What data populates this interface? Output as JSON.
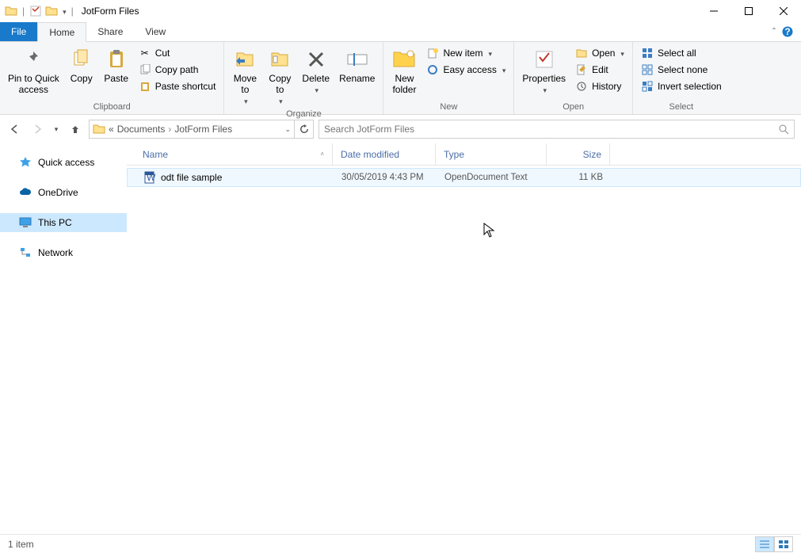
{
  "title": "JotForm Files",
  "tabs": {
    "file": "File",
    "home": "Home",
    "share": "Share",
    "view": "View"
  },
  "ribbon": {
    "clipboard": {
      "pin": "Pin to Quick\naccess",
      "copy": "Copy",
      "paste": "Paste",
      "cut": "Cut",
      "copypath": "Copy path",
      "pasteshortcut": "Paste shortcut",
      "label": "Clipboard"
    },
    "organize": {
      "moveto": "Move\nto",
      "copyto": "Copy\nto",
      "delete": "Delete",
      "rename": "Rename",
      "label": "Organize"
    },
    "new": {
      "newfolder": "New\nfolder",
      "newitem": "New item",
      "easyaccess": "Easy access",
      "label": "New"
    },
    "open": {
      "properties": "Properties",
      "open": "Open",
      "edit": "Edit",
      "history": "History",
      "label": "Open"
    },
    "select": {
      "all": "Select all",
      "none": "Select none",
      "invert": "Invert selection",
      "label": "Select"
    }
  },
  "breadcrumb": {
    "root": "«",
    "a": "Documents",
    "b": "JotForm Files"
  },
  "search_placeholder": "Search JotForm Files",
  "nav": {
    "quick": "Quick access",
    "onedrive": "OneDrive",
    "thispc": "This PC",
    "network": "Network"
  },
  "columns": {
    "name": "Name",
    "date": "Date modified",
    "type": "Type",
    "size": "Size"
  },
  "files": [
    {
      "name": "odt file sample",
      "date": "30/05/2019 4:43 PM",
      "type": "OpenDocument Text",
      "size": "11 KB"
    }
  ],
  "status": "1 item"
}
